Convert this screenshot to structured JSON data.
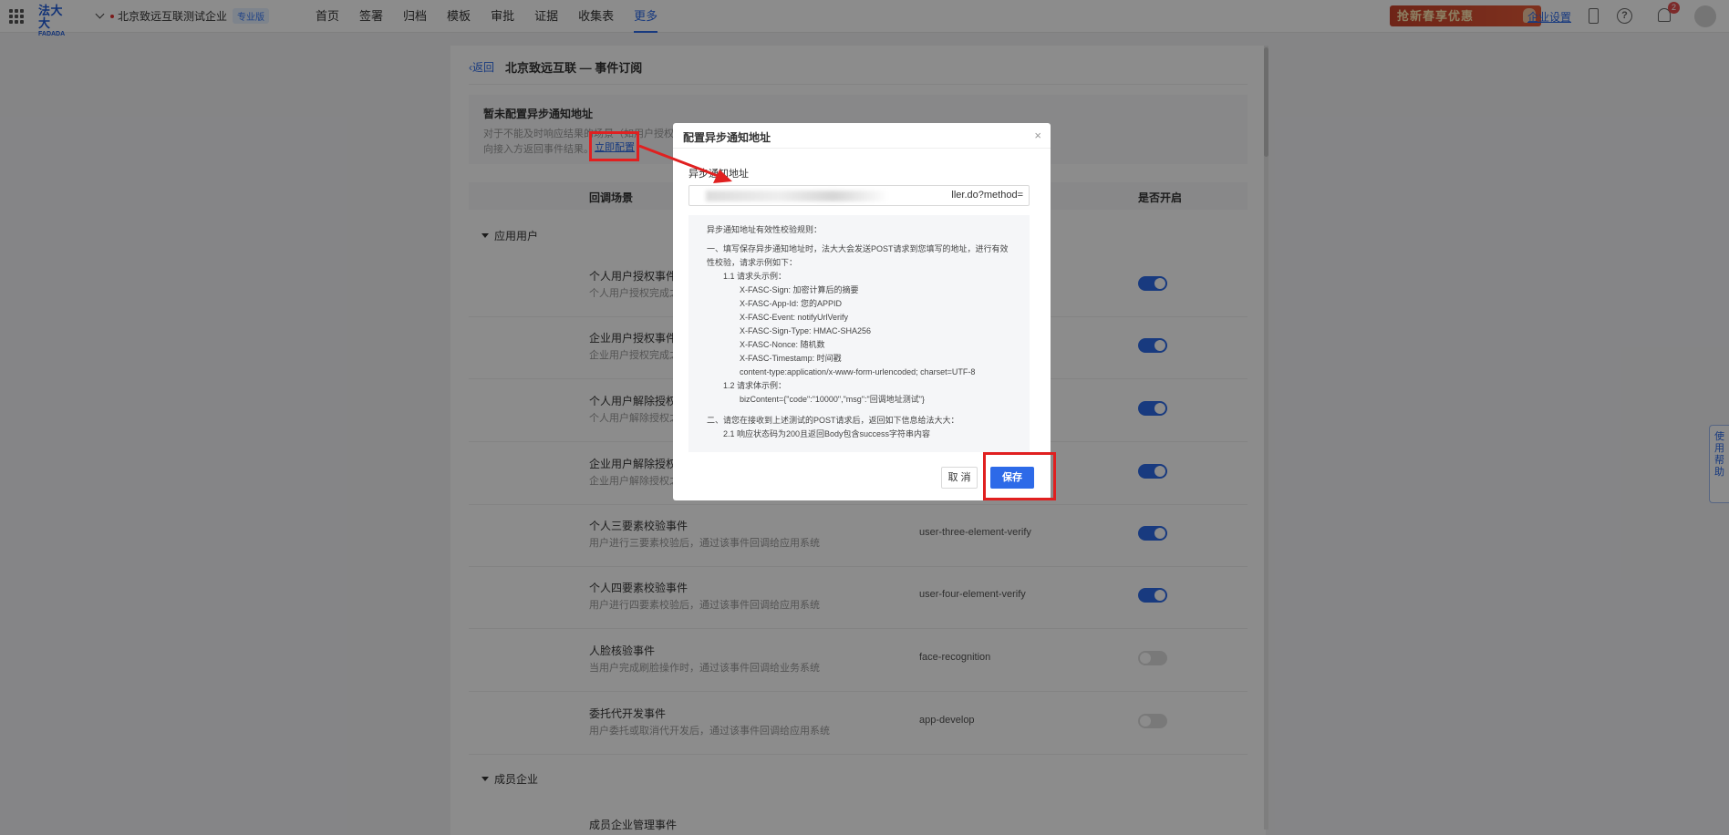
{
  "topbar": {
    "logo_cn": "法大大",
    "logo_en": "FADADA",
    "company_name": "北京致远互联测试企业",
    "company_badge": "专业版",
    "nav": [
      "首页",
      "签署",
      "归档",
      "模板",
      "审批",
      "证据",
      "收集表",
      "更多"
    ],
    "active_nav": "更多",
    "promo_text": "抢新春享优惠",
    "company_settings": "企业设置",
    "notification_count": "2"
  },
  "page": {
    "back_label": "返回",
    "title": "北京致远互联 — 事件订阅",
    "notice_title": "暂未配置异步通知地址",
    "notice_text": "对于不能及时响应结果的场景（如用户授权面",
    "notice_text_2": "向接入方返回事件结果。",
    "configure_link": "立即配置",
    "columns": [
      "回调场景",
      "是否开启"
    ],
    "group_app_users": "应用用户",
    "group_member_companies": "成员企业",
    "rows": [
      {
        "name": "个人用户授权事件",
        "desc": "个人用户授权完成之",
        "code": "",
        "enabled": true
      },
      {
        "name": "企业用户授权事件",
        "desc": "企业用户授权完成之",
        "code": "",
        "enabled": true
      },
      {
        "name": "个人用户解除授权事",
        "desc": "个人用户解除授权之",
        "code": "",
        "enabled": true
      },
      {
        "name": "企业用户解除授权事",
        "desc": "企业用户解除授权之",
        "code": "",
        "enabled": true
      },
      {
        "name": "个人三要素校验事件",
        "desc": "用户进行三要素校验后，通过该事件回调给应用系统",
        "code": "user-three-element-verify",
        "enabled": true
      },
      {
        "name": "个人四要素校验事件",
        "desc": "用户进行四要素校验后，通过该事件回调给应用系统",
        "code": "user-four-element-verify",
        "enabled": true
      },
      {
        "name": "人脸核验事件",
        "desc": "当用户完成刷脸操作时，通过该事件回调给业务系统",
        "code": "face-recognition",
        "enabled": false
      },
      {
        "name": "委托代开发事件",
        "desc": "用户委托或取消代开发后，通过该事件回调给应用系统",
        "code": "app-develop",
        "enabled": false
      }
    ],
    "member_row_name": "成员企业管理事件",
    "side_help": "使用帮助"
  },
  "modal": {
    "title": "配置异步通知地址",
    "field_label": "异步通知地址",
    "url_value": "ller.do?method=",
    "rules": [
      {
        "level": 1,
        "text": "异步通知地址有效性校验规则："
      },
      {
        "level": 1,
        "text": "一、填写保存异步通知地址时，法大大会发送POST请求到您填写的地址，进行有效"
      },
      {
        "level": 1,
        "text": "性校验，请求示例如下："
      },
      {
        "level": 2,
        "text": "1.1 请求头示例："
      },
      {
        "level": 3,
        "text": "X-FASC-Sign: 加密计算后的摘要"
      },
      {
        "level": 3,
        "text": "X-FASC-App-Id: 您的APPID"
      },
      {
        "level": 3,
        "text": "X-FASC-Event: notifyUrlVerify"
      },
      {
        "level": 3,
        "text": "X-FASC-Sign-Type: HMAC-SHA256"
      },
      {
        "level": 3,
        "text": "X-FASC-Nonce: 随机数"
      },
      {
        "level": 3,
        "text": "X-FASC-Timestamp: 时间戳"
      },
      {
        "level": 3,
        "text": "content-type:application/x-www-form-urlencoded; charset=UTF-8"
      },
      {
        "level": 2,
        "text": "1.2 请求体示例："
      },
      {
        "level": 3,
        "text": "bizContent={\"code\":\"10000\",\"msg\":\"回调地址测试\"}"
      },
      {
        "level": 1,
        "text": "二、请您在接收到上述测试的POST请求后，返回如下信息给法大大："
      },
      {
        "level": 2,
        "text": "2.1 响应状态码为200且返回Body包含success字符串内容"
      }
    ],
    "cancel_label": "取 消",
    "save_label": "保存"
  },
  "colors": {
    "accent": "#2d6ae8",
    "annotation": "#e02020",
    "promo": "#d44a2f"
  }
}
